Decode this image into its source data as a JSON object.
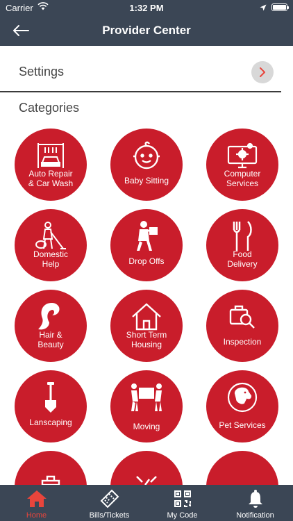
{
  "status_bar": {
    "carrier": "Carrier",
    "time": "1:32 PM"
  },
  "nav": {
    "title": "Provider Center"
  },
  "settings": {
    "label": "Settings"
  },
  "categories": {
    "title": "Categories",
    "items": [
      {
        "label": "Auto Repair\n& Car Wash",
        "icon": "car-wash-icon"
      },
      {
        "label": "Baby Sitting",
        "icon": "baby-face-icon"
      },
      {
        "label": "Computer\nServices",
        "icon": "computer-gear-icon"
      },
      {
        "label": "Domestic\nHelp",
        "icon": "vacuum-cleaning-icon"
      },
      {
        "label": "Drop Offs",
        "icon": "delivery-person-icon"
      },
      {
        "label": "Food\nDelivery",
        "icon": "fork-knife-icon"
      },
      {
        "label": "Hair &\nBeauty",
        "icon": "woman-hair-icon"
      },
      {
        "label": "Short Term\nHousing",
        "icon": "house-icon"
      },
      {
        "label": "Inspection",
        "icon": "inspection-magnifier-icon"
      },
      {
        "label": "Lanscaping",
        "icon": "shovel-icon"
      },
      {
        "label": "Moving",
        "icon": "movers-box-icon"
      },
      {
        "label": "Pet Services",
        "icon": "dog-icon"
      }
    ]
  },
  "tabbar": {
    "tabs": [
      {
        "label": "Home",
        "icon": "home-icon",
        "active": true
      },
      {
        "label": "Bills/Tickets",
        "icon": "ticket-icon",
        "active": false
      },
      {
        "label": "My Code",
        "icon": "qr-code-icon",
        "active": false
      },
      {
        "label": "Notification",
        "icon": "bell-icon",
        "active": false
      }
    ]
  },
  "colors": {
    "header": "#3b4655",
    "accent": "#c91d2b",
    "active_tab": "#e8453c"
  }
}
